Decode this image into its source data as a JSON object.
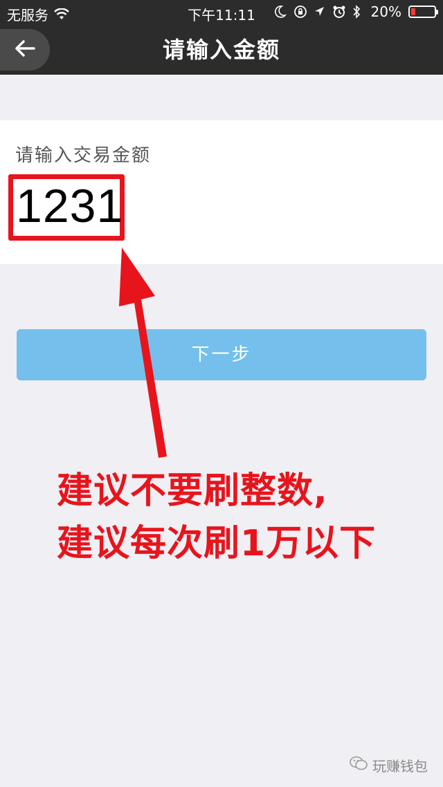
{
  "status_bar": {
    "carrier": "无服务",
    "time": "下午11:11",
    "battery": "20%",
    "battery_level": 0.2,
    "icons": [
      "wifi-icon",
      "moon-icon",
      "rotation-lock-icon",
      "location-icon",
      "alarm-icon",
      "bluetooth-icon",
      "battery-icon"
    ]
  },
  "nav": {
    "title": "请输入金额",
    "back_icon": "back-arrow-icon"
  },
  "form": {
    "label": "请输入交易金额",
    "amount": "1231"
  },
  "next_button": {
    "label": "下一步"
  },
  "annotation": {
    "line1": "建议不要刷整数,",
    "line2": "建议每次刷1万以下"
  },
  "watermark": {
    "text": "玩赚钱包",
    "icon": "wechat-icon"
  },
  "colors": {
    "nav_bg": "#2c2c2c",
    "page_bg": "#efeff4",
    "button_bg": "#74bfeb",
    "highlight_red": "#e8141c"
  }
}
